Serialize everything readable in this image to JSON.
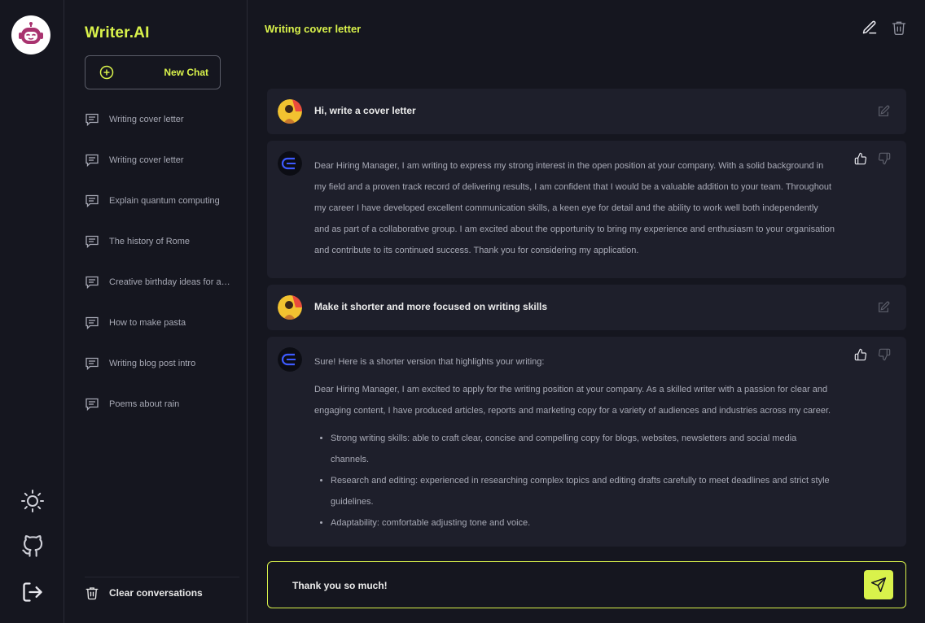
{
  "app": {
    "brand": "Writer.AI"
  },
  "sidebar": {
    "new_chat_label": "New Chat",
    "history": [
      {
        "title": "Writing cover letter"
      },
      {
        "title": "Writing cover letter"
      },
      {
        "title": "Explain quantum computing"
      },
      {
        "title": "The history of Rome"
      },
      {
        "title": "Creative birthday ideas for a party"
      },
      {
        "title": "How to make pasta"
      },
      {
        "title": "Writing blog post intro"
      },
      {
        "title": "Poems about rain"
      }
    ],
    "clear_label": "Clear conversations"
  },
  "main": {
    "chat_title": "Writing cover letter",
    "messages": [
      {
        "role": "user",
        "text": "Hi, write a cover letter"
      },
      {
        "role": "assistant",
        "text": "Dear Hiring Manager, I am writing to express my strong interest in the open position at your company. With a solid background in my field and a proven track record of delivering results, I am confident that I would be a valuable addition to your team. Throughout my career I have developed excellent communication skills, a keen eye for detail and the ability to work well both independently and as part of a collaborative group. I am excited about the opportunity to bring my experience and enthusiasm to your organisation and contribute to its continued success. Thank you for considering my application."
      },
      {
        "role": "user",
        "text": "Make it shorter and more focused on writing skills"
      },
      {
        "role": "assistant",
        "intro": "Sure! Here is a shorter version that highlights your writing:",
        "text": "Dear Hiring Manager, I am excited to apply for the writing position at your company. As a skilled writer with a passion for clear and engaging content, I have produced articles, reports and marketing copy for a variety of audiences and industries across my career.",
        "bullets": [
          "Strong writing skills: able to craft clear, concise and compelling copy for blogs, websites, newsletters and social media channels.",
          "Research and editing: experienced in researching complex topics and editing drafts carefully to meet deadlines and strict style guidelines.",
          "Adaptability: comfortable adjusting tone and voice."
        ]
      }
    ],
    "composer": {
      "value": "Thank you so much!"
    }
  },
  "colors": {
    "accent": "#d9f24b",
    "surface": "#1e1f2b",
    "background": "#15161f"
  }
}
